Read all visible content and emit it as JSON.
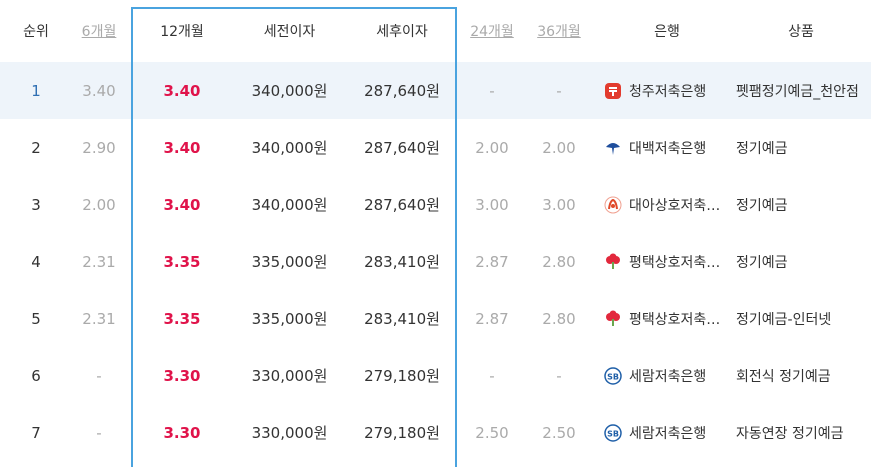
{
  "headers": {
    "rank": "순위",
    "m6": "6개월",
    "m12": "12개월",
    "pre_tax": "세전이자",
    "post_tax": "세후이자",
    "m24": "24개월",
    "m36": "36개월",
    "bank": "은행",
    "product": "상품"
  },
  "rows": [
    {
      "rank": "1",
      "m6": "3.40",
      "m12": "3.40",
      "pre": "340,000원",
      "post": "287,640원",
      "m24": "-",
      "m36": "-",
      "bank": "청주저축은행",
      "bank_icon": "cheongju-bank-icon",
      "product": "펫팸정기예금_천안점"
    },
    {
      "rank": "2",
      "m6": "2.90",
      "m12": "3.40",
      "pre": "340,000원",
      "post": "287,640원",
      "m24": "2.00",
      "m36": "2.00",
      "bank": "대백저축은행",
      "bank_icon": "daebaek-bank-icon",
      "product": "정기예금"
    },
    {
      "rank": "3",
      "m6": "2.00",
      "m12": "3.40",
      "pre": "340,000원",
      "post": "287,640원",
      "m24": "3.00",
      "m36": "3.00",
      "bank": "대아상호저축은행",
      "bank_icon": "daea-bank-icon",
      "product": "정기예금"
    },
    {
      "rank": "4",
      "m6": "2.31",
      "m12": "3.35",
      "pre": "335,000원",
      "post": "283,410원",
      "m24": "2.87",
      "m36": "2.80",
      "bank": "평택상호저축은행",
      "bank_icon": "pyeongtaek-bank-icon",
      "product": "정기예금"
    },
    {
      "rank": "5",
      "m6": "2.31",
      "m12": "3.35",
      "pre": "335,000원",
      "post": "283,410원",
      "m24": "2.87",
      "m36": "2.80",
      "bank": "평택상호저축은행",
      "bank_icon": "pyeongtaek-bank-icon",
      "product": "정기예금-인터넷"
    },
    {
      "rank": "6",
      "m6": "-",
      "m12": "3.30",
      "pre": "330,000원",
      "post": "279,180원",
      "m24": "-",
      "m36": "-",
      "bank": "세람저축은행",
      "bank_icon": "seram-bank-icon",
      "product": "회전식 정기예금"
    },
    {
      "rank": "7",
      "m6": "-",
      "m12": "3.30",
      "pre": "330,000원",
      "post": "279,180원",
      "m24": "2.50",
      "m36": "2.50",
      "bank": "세람저축은행",
      "bank_icon": "seram-bank-icon",
      "product": "자동연장 정기예금"
    }
  ],
  "colors": {
    "rate12": "#e0134a",
    "highlight": "#eef4fa",
    "box": "#4aa3df",
    "muted": "#aaaaaa"
  }
}
